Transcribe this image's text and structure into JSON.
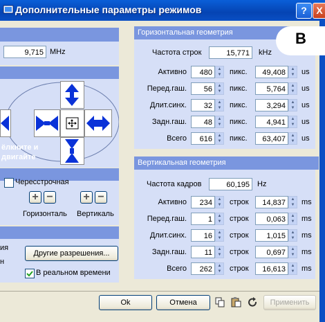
{
  "window": {
    "title": "Дополнительные параметры режимов",
    "help": "?",
    "close": "X"
  },
  "badge": "B",
  "left": {
    "freq_value": "9,715",
    "freq_unit": "MHz",
    "hint_line1": "ёлкните и",
    "hint_line2": "двигайте",
    "interlace_label": "Чересстрочная",
    "horizontal_label": "Горизонталь",
    "vertical_label": "Вертикаль",
    "plus": "+",
    "minus": "−",
    "stub1": "ия",
    "stub2": "н",
    "other_res_button": "Другие разрешения...",
    "realtime_label": "В реальном времени"
  },
  "hgeom": {
    "header": "Горизонтальная геометрия",
    "freq_label": "Частота строк",
    "freq_value": "15,771",
    "freq_unit": "kHz",
    "rows": [
      {
        "label": "Активно",
        "px": "480",
        "px_unit": "пикс.",
        "us": "49,408",
        "us_unit": "us"
      },
      {
        "label": "Перед.гаш.",
        "px": "56",
        "px_unit": "пикс.",
        "us": "5,764",
        "us_unit": "us"
      },
      {
        "label": "Длит.синх.",
        "px": "32",
        "px_unit": "пикс.",
        "us": "3,294",
        "us_unit": "us"
      },
      {
        "label": "Задн.гаш.",
        "px": "48",
        "px_unit": "пикс.",
        "us": "4,941",
        "us_unit": "us"
      },
      {
        "label": "Всего",
        "px": "616",
        "px_unit": "пикс.",
        "us": "63,407",
        "us_unit": "us"
      }
    ]
  },
  "vgeom": {
    "header": "Вертикальная геометрия",
    "freq_label": "Частота кадров",
    "freq_value": "60,195",
    "freq_unit": "Hz",
    "rows": [
      {
        "label": "Активно",
        "lines": "234",
        "lines_unit": "строк",
        "ms": "14,837",
        "ms_unit": "ms"
      },
      {
        "label": "Перед.гаш.",
        "lines": "1",
        "lines_unit": "строк",
        "ms": "0,063",
        "ms_unit": "ms"
      },
      {
        "label": "Длит.синх.",
        "lines": "16",
        "lines_unit": "строк",
        "ms": "1,015",
        "ms_unit": "ms"
      },
      {
        "label": "Задн.гаш.",
        "lines": "11",
        "lines_unit": "строк",
        "ms": "0,697",
        "ms_unit": "ms"
      },
      {
        "label": "Всего",
        "lines": "262",
        "lines_unit": "строк",
        "ms": "16,613",
        "ms_unit": "ms"
      }
    ]
  },
  "footer": {
    "ok": "Ok",
    "cancel": "Отмена",
    "apply": "Применить"
  }
}
